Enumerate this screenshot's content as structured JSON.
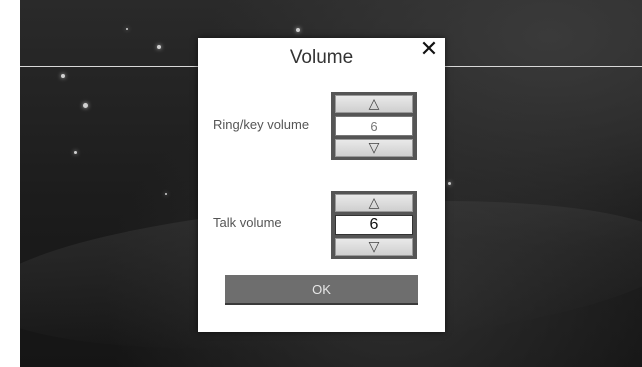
{
  "dialog": {
    "title": "Volume",
    "close_glyph": "✕",
    "ok_label": "OK"
  },
  "ring": {
    "label": "Ring/key volume",
    "value": "6",
    "up_glyph": "△",
    "down_glyph": "▽"
  },
  "talk": {
    "label": "Talk volume",
    "value": "6",
    "up_glyph": "△",
    "down_glyph": "▽"
  },
  "icons": [
    "close-icon",
    "triangle-up-icon",
    "triangle-down-icon"
  ],
  "colors": {
    "background": "#1c1c1c",
    "dialog": "#ffffff",
    "ok_button": "#6e6e6e",
    "stepper_frame": "#555555"
  }
}
